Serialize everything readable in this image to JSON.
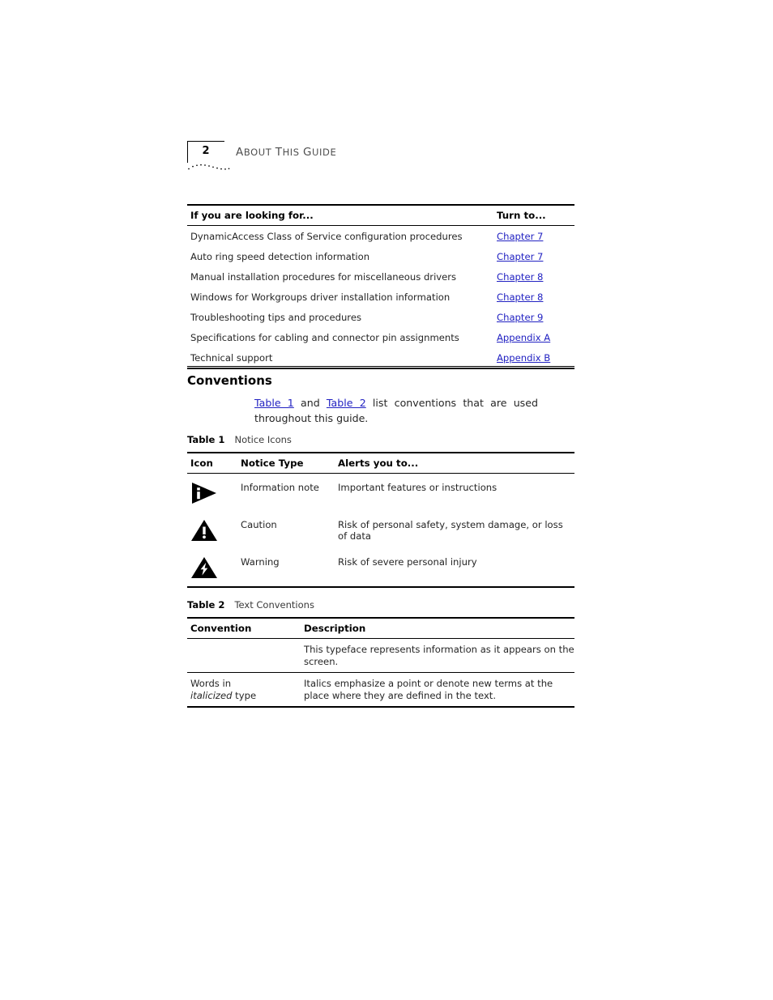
{
  "page": {
    "number": "2",
    "running_head": "About This Guide"
  },
  "colors": {
    "link": "#2222c2",
    "rule": "#000000",
    "body_text": "#262626"
  },
  "lookup_table": {
    "headers": [
      "If you are looking for...",
      "Turn to..."
    ],
    "rows": [
      {
        "topic": "DynamicAccess Class of Service configuration procedures",
        "target": "Chapter 7"
      },
      {
        "topic": "Auto ring speed detection information",
        "target": "Chapter 7"
      },
      {
        "topic": "Manual installation procedures for miscellaneous drivers",
        "target": "Chapter 8"
      },
      {
        "topic": "Windows for Workgroups driver installation information",
        "target": "Chapter 8"
      },
      {
        "topic": "Troubleshooting tips and procedures",
        "target": "Chapter 9"
      },
      {
        "topic": "Specifications for cabling and connector pin assignments",
        "target": "Appendix A"
      },
      {
        "topic": "Technical support",
        "target": "Appendix B"
      }
    ]
  },
  "conventions": {
    "heading": "Conventions",
    "intro": {
      "link1": "Table 1",
      "between": " and ",
      "link2": "Table 2",
      "tail": " list conventions that are used throughout this guide."
    }
  },
  "table1": {
    "caption_label": "Table 1",
    "caption_name": "Notice Icons",
    "headers": [
      "Icon",
      "Notice Type",
      "Alerts you to..."
    ],
    "rows": [
      {
        "icon": "information-note-icon",
        "type": "Information note",
        "alert": "Important features or instructions"
      },
      {
        "icon": "caution-icon",
        "type": "Caution",
        "alert": "Risk of personal safety, system damage, or loss of data"
      },
      {
        "icon": "warning-icon",
        "type": "Warning",
        "alert": "Risk of severe personal injury"
      }
    ]
  },
  "table2": {
    "caption_label": "Table 2",
    "caption_name": "Text Conventions",
    "headers": [
      "Convention",
      "Description"
    ],
    "rows": [
      {
        "convention_plain": "",
        "convention_italic": "",
        "convention_tail": "",
        "description": "This typeface represents information as it appears on the screen."
      },
      {
        "convention_plain": "Words in",
        "convention_italic": "italicized",
        "convention_tail": " type",
        "description": "Italics emphasize a point or denote new terms at the place where they are defined in the text."
      }
    ]
  }
}
